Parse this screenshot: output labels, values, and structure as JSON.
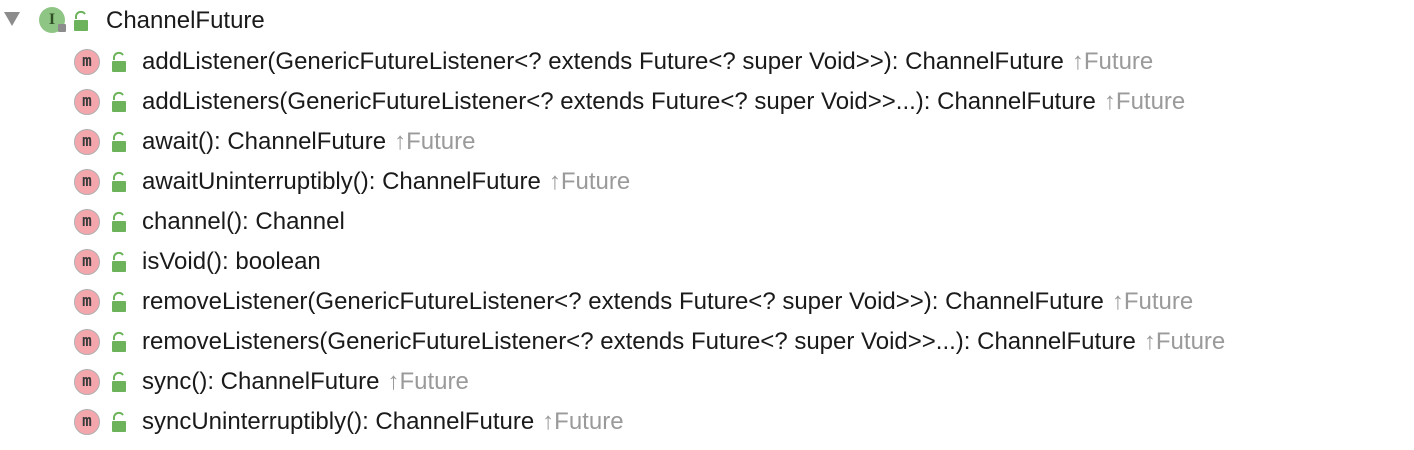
{
  "root": {
    "icon_letter": "I",
    "label": "ChannelFuture"
  },
  "method_icon_letter": "m",
  "inherit_arrow": "↑",
  "methods": [
    {
      "signature": "addListener(GenericFutureListener<? extends Future<? super Void>>): ChannelFuture",
      "inherited_from": "Future"
    },
    {
      "signature": "addListeners(GenericFutureListener<? extends Future<? super Void>>...): ChannelFuture",
      "inherited_from": "Future"
    },
    {
      "signature": "await(): ChannelFuture",
      "inherited_from": "Future"
    },
    {
      "signature": "awaitUninterruptibly(): ChannelFuture",
      "inherited_from": "Future"
    },
    {
      "signature": "channel(): Channel",
      "inherited_from": ""
    },
    {
      "signature": "isVoid(): boolean",
      "inherited_from": ""
    },
    {
      "signature": "removeListener(GenericFutureListener<? extends Future<? super Void>>): ChannelFuture",
      "inherited_from": "Future"
    },
    {
      "signature": "removeListeners(GenericFutureListener<? extends Future<? super Void>>...): ChannelFuture",
      "inherited_from": "Future"
    },
    {
      "signature": "sync(): ChannelFuture",
      "inherited_from": "Future"
    },
    {
      "signature": "syncUninterruptibly(): ChannelFuture",
      "inherited_from": "Future"
    }
  ],
  "colors": {
    "interface_icon": "#8fc584",
    "method_icon": "#f4a6ad",
    "unlock_icon": "#6cb35b",
    "inherited_text": "#9a9a9a"
  }
}
